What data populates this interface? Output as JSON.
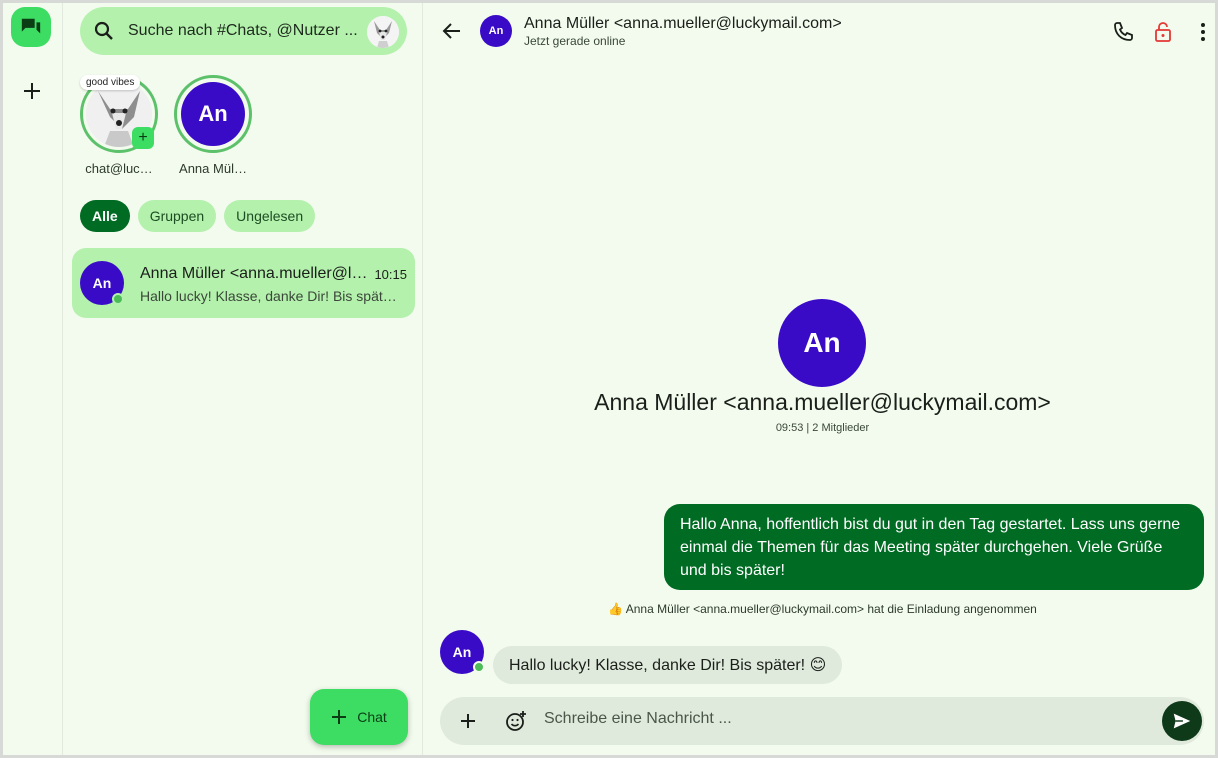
{
  "rail": {
    "chats_icon": "chat-bubbles-icon",
    "add_icon": "plus-icon"
  },
  "search": {
    "placeholder": "Suche nach #Chats, @Nutzer ...",
    "icon": "search-icon"
  },
  "stories": [
    {
      "label": "chat@luc…",
      "bubble": "good vibes",
      "type": "image"
    },
    {
      "label": "Anna Mül…",
      "initials": "An",
      "type": "avatar"
    }
  ],
  "filters": [
    {
      "label": "Alle",
      "active": true
    },
    {
      "label": "Gruppen",
      "active": false
    },
    {
      "label": "Ungelesen",
      "active": false
    }
  ],
  "conversations": [
    {
      "initials": "An",
      "name": "Anna Müller <anna.mueller@luckymail.com>",
      "time": "10:15",
      "preview": "Hallo lucky! Klasse, danke Dir! Bis später! 😊",
      "online": true
    }
  ],
  "fab": {
    "label": "Chat"
  },
  "chat": {
    "header": {
      "initials": "An",
      "title": "Anna Müller <anna.mueller@luckymail.com>",
      "status": "Jetzt gerade online"
    },
    "intro": {
      "initials": "An",
      "name": "Anna Müller <anna.mueller@luckymail.com>",
      "meta": "09:53 | 2 Mitglieder"
    },
    "messages": {
      "outgoing": "Hallo Anna, hoffentlich bist du gut in den Tag gestartet. Lass uns gerne einmal die Themen für das Meeting später durchgehen. Viele Grüße und bis später!",
      "system": "👍 Anna Müller <anna.mueller@luckymail.com> hat die Einladung angenommen",
      "incoming_initials": "An",
      "incoming": "Hallo lucky! Klasse, danke Dir! Bis später! 😊"
    },
    "composer": {
      "placeholder": "Schreibe eine Nachricht ..."
    }
  },
  "colors": {
    "background": "#f3fbee",
    "accent": "#3ddc63",
    "chip": "#b4f1ad",
    "dark_green": "#006b22",
    "avatar": "#3a0bc7",
    "lock_red": "#e53935"
  }
}
